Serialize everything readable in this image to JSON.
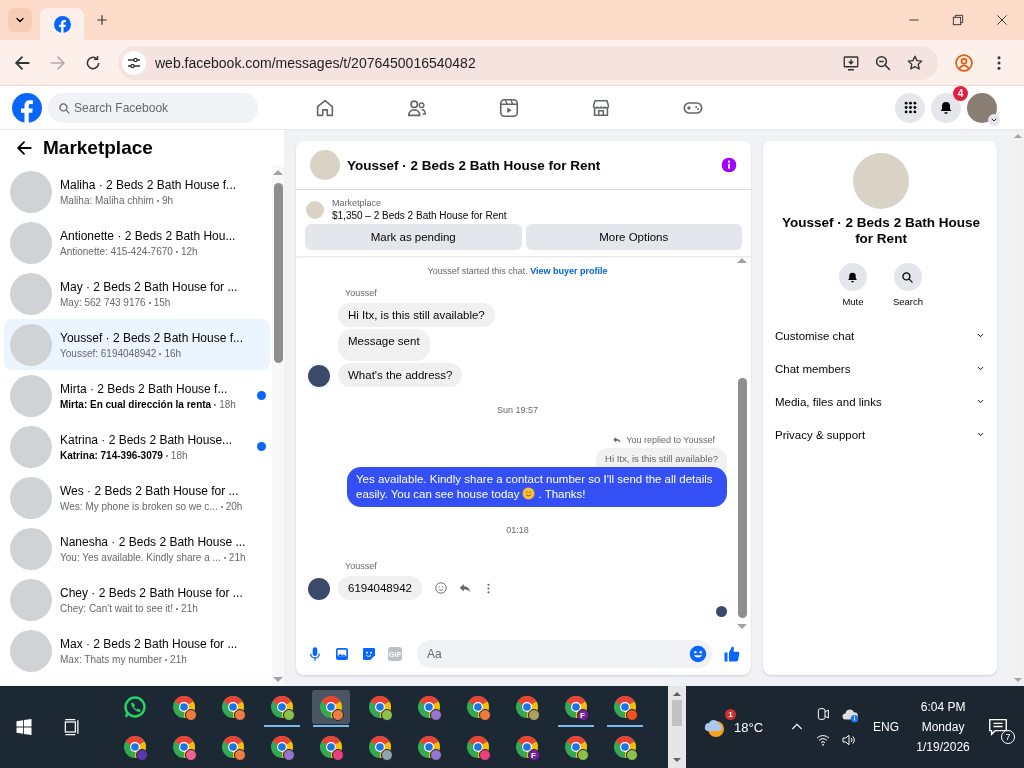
{
  "browser": {
    "address": "web.facebook.com/messages/t/2076450016540482"
  },
  "nav": {
    "search_placeholder": "Search Facebook",
    "notification_count": "4"
  },
  "sidebar": {
    "title": "Marketplace",
    "conversations": [
      {
        "title": "Maliha · 2 Beds 2 Bath House f...",
        "preview": "Maliha: Maliha chhim",
        "time": "9h",
        "selected": false,
        "unread": false
      },
      {
        "title": "Antionette · 2 Beds 2 Bath Hou...",
        "preview": "Antionette: 415-424-7670",
        "time": "12h",
        "selected": false,
        "unread": false
      },
      {
        "title": "May · 2 Beds 2 Bath House for ...",
        "preview": "May: 562 743 9176",
        "time": "15h",
        "selected": false,
        "unread": false
      },
      {
        "title": "Youssef · 2 Beds 2 Bath House f...",
        "preview": "Youssef: 6194048942",
        "time": "16h",
        "selected": true,
        "unread": false
      },
      {
        "title": "Mirta · 2 Beds 2 Bath House f...",
        "preview": "Mirta: En cual dirección la renta",
        "time": "18h",
        "selected": false,
        "unread": true
      },
      {
        "title": "Katrina · 2 Beds 2 Bath House...",
        "preview": "Katrina: 714-396-3079",
        "time": "18h",
        "selected": false,
        "unread": true
      },
      {
        "title": "Wes · 2 Beds 2 Bath House for ...",
        "preview": "Wes: My phone is broken so we c...",
        "time": "20h",
        "selected": false,
        "unread": false
      },
      {
        "title": "Nanesha · 2 Beds 2 Bath House ...",
        "preview": "You: Yes available. Kindly share a ...",
        "time": "21h",
        "selected": false,
        "unread": false
      },
      {
        "title": "Chey · 2 Beds 2 Bath House for ...",
        "preview": "Chey: Can't wait to see it!",
        "time": "21h",
        "selected": false,
        "unread": false
      },
      {
        "title": "Max · 2 Beds 2 Bath House for ...",
        "preview": "Max: Thats my number",
        "time": "21h",
        "selected": false,
        "unread": false
      }
    ]
  },
  "chat": {
    "title": "Youssef · 2 Beds 2 Bath House for Rent",
    "listing": {
      "label": "Marketplace",
      "summary": "$1,350 – 2 Beds 2 Bath House for Rent"
    },
    "buttons": [
      "Mark as pending",
      "More Options"
    ],
    "messages": [
      {
        "kind": "notice",
        "text": "Youssef started this chat.",
        "link": "View buyer profile"
      },
      {
        "kind": "sender",
        "text": "Youssef"
      },
      {
        "kind": "incoming",
        "text": "Hi Itx, is this still available?",
        "avatar": false,
        "actions": false
      },
      {
        "kind": "incoming",
        "text": "Message sent",
        "avatar": false,
        "actions": false
      },
      {
        "kind": "incoming",
        "text": "What's the address?",
        "avatar": true,
        "actions": false
      },
      {
        "kind": "time",
        "text": "Sun 19:57"
      },
      {
        "kind": "reply_note",
        "text": "You replied to Youssef"
      },
      {
        "kind": "quote",
        "text": "Hi Itx, is this still available?"
      },
      {
        "kind": "outgoing",
        "text": "Yes available. Kindly share a contact number so I'll send the all details easily. You can see house today",
        "text_after": ". Thanks!"
      },
      {
        "kind": "time",
        "text": "01:18"
      },
      {
        "kind": "sender",
        "text": "Youssef"
      },
      {
        "kind": "incoming",
        "text": "6194048942",
        "avatar": true,
        "actions": true
      },
      {
        "kind": "seen"
      }
    ],
    "composer": {
      "gif": "GIF",
      "placeholder": "Aa"
    }
  },
  "info": {
    "title": "Youssef · 2 Beds 2 Bath House for Rent",
    "actions": [
      {
        "kind": "mute",
        "label": "Mute"
      },
      {
        "kind": "search",
        "label": "Search"
      }
    ],
    "sections": [
      "Customise chat",
      "Chat members",
      "Media, files and links",
      "Privacy & support"
    ]
  },
  "taskbar": {
    "rows": [
      [
        {
          "kind": "whatsapp",
          "open": false,
          "selected": false
        },
        {
          "kind": "chrome",
          "color": "#f07b3f",
          "open": false,
          "selected": false
        },
        {
          "kind": "chrome",
          "color": "#f07b3f",
          "open": false,
          "selected": false
        },
        {
          "kind": "chrome",
          "color": "#8bc34a",
          "open": true,
          "selected": false
        },
        {
          "kind": "chrome",
          "color": "#f07b3f",
          "open": true,
          "selected": true
        },
        {
          "kind": "chrome",
          "color": "#8bc34a",
          "open": false,
          "selected": false
        },
        {
          "kind": "chrome",
          "color": "#9575cd",
          "open": false,
          "selected": false
        },
        {
          "kind": "chrome",
          "color": "#f07b3f",
          "open": false,
          "selected": false
        },
        {
          "kind": "chrome",
          "color": "#b0a060",
          "open": false,
          "selected": false
        },
        {
          "kind": "chrome",
          "color": "#7b1fa2",
          "label": "F",
          "open": true,
          "selected": false
        },
        {
          "kind": "chrome",
          "color": "#f4511e",
          "open": true,
          "selected": false
        }
      ],
      [
        {
          "kind": "chrome",
          "color": "#5e35b1",
          "open": false,
          "selected": false
        },
        {
          "kind": "chrome",
          "color": "#f06292",
          "open": false,
          "selected": false
        },
        {
          "kind": "chrome",
          "color": "#f07b3f",
          "open": false,
          "selected": false
        },
        {
          "kind": "chrome",
          "color": "#9575cd",
          "open": false,
          "selected": false
        },
        {
          "kind": "chrome",
          "color": "#ec407a",
          "open": false,
          "selected": false
        },
        {
          "kind": "chrome",
          "color": "#90a4ae",
          "open": false,
          "selected": false
        },
        {
          "kind": "chrome",
          "color": "#9575cd",
          "open": false,
          "selected": false
        },
        {
          "kind": "chrome",
          "color": "#ec407a",
          "open": false,
          "selected": false
        },
        {
          "kind": "chrome",
          "color": "#7b1fa2",
          "label": "F",
          "open": false,
          "selected": false
        },
        {
          "kind": "chrome",
          "color": "#8bc34a",
          "open": false,
          "selected": false
        },
        {
          "kind": "chrome",
          "color": "#8bc34a",
          "open": false,
          "selected": false
        }
      ]
    ],
    "weather": {
      "temperature": "18°C",
      "badge": "1"
    },
    "language": "ENG",
    "time": "6:04 PM",
    "day": "Monday",
    "date": "1/19/2026",
    "notifications": "7"
  }
}
